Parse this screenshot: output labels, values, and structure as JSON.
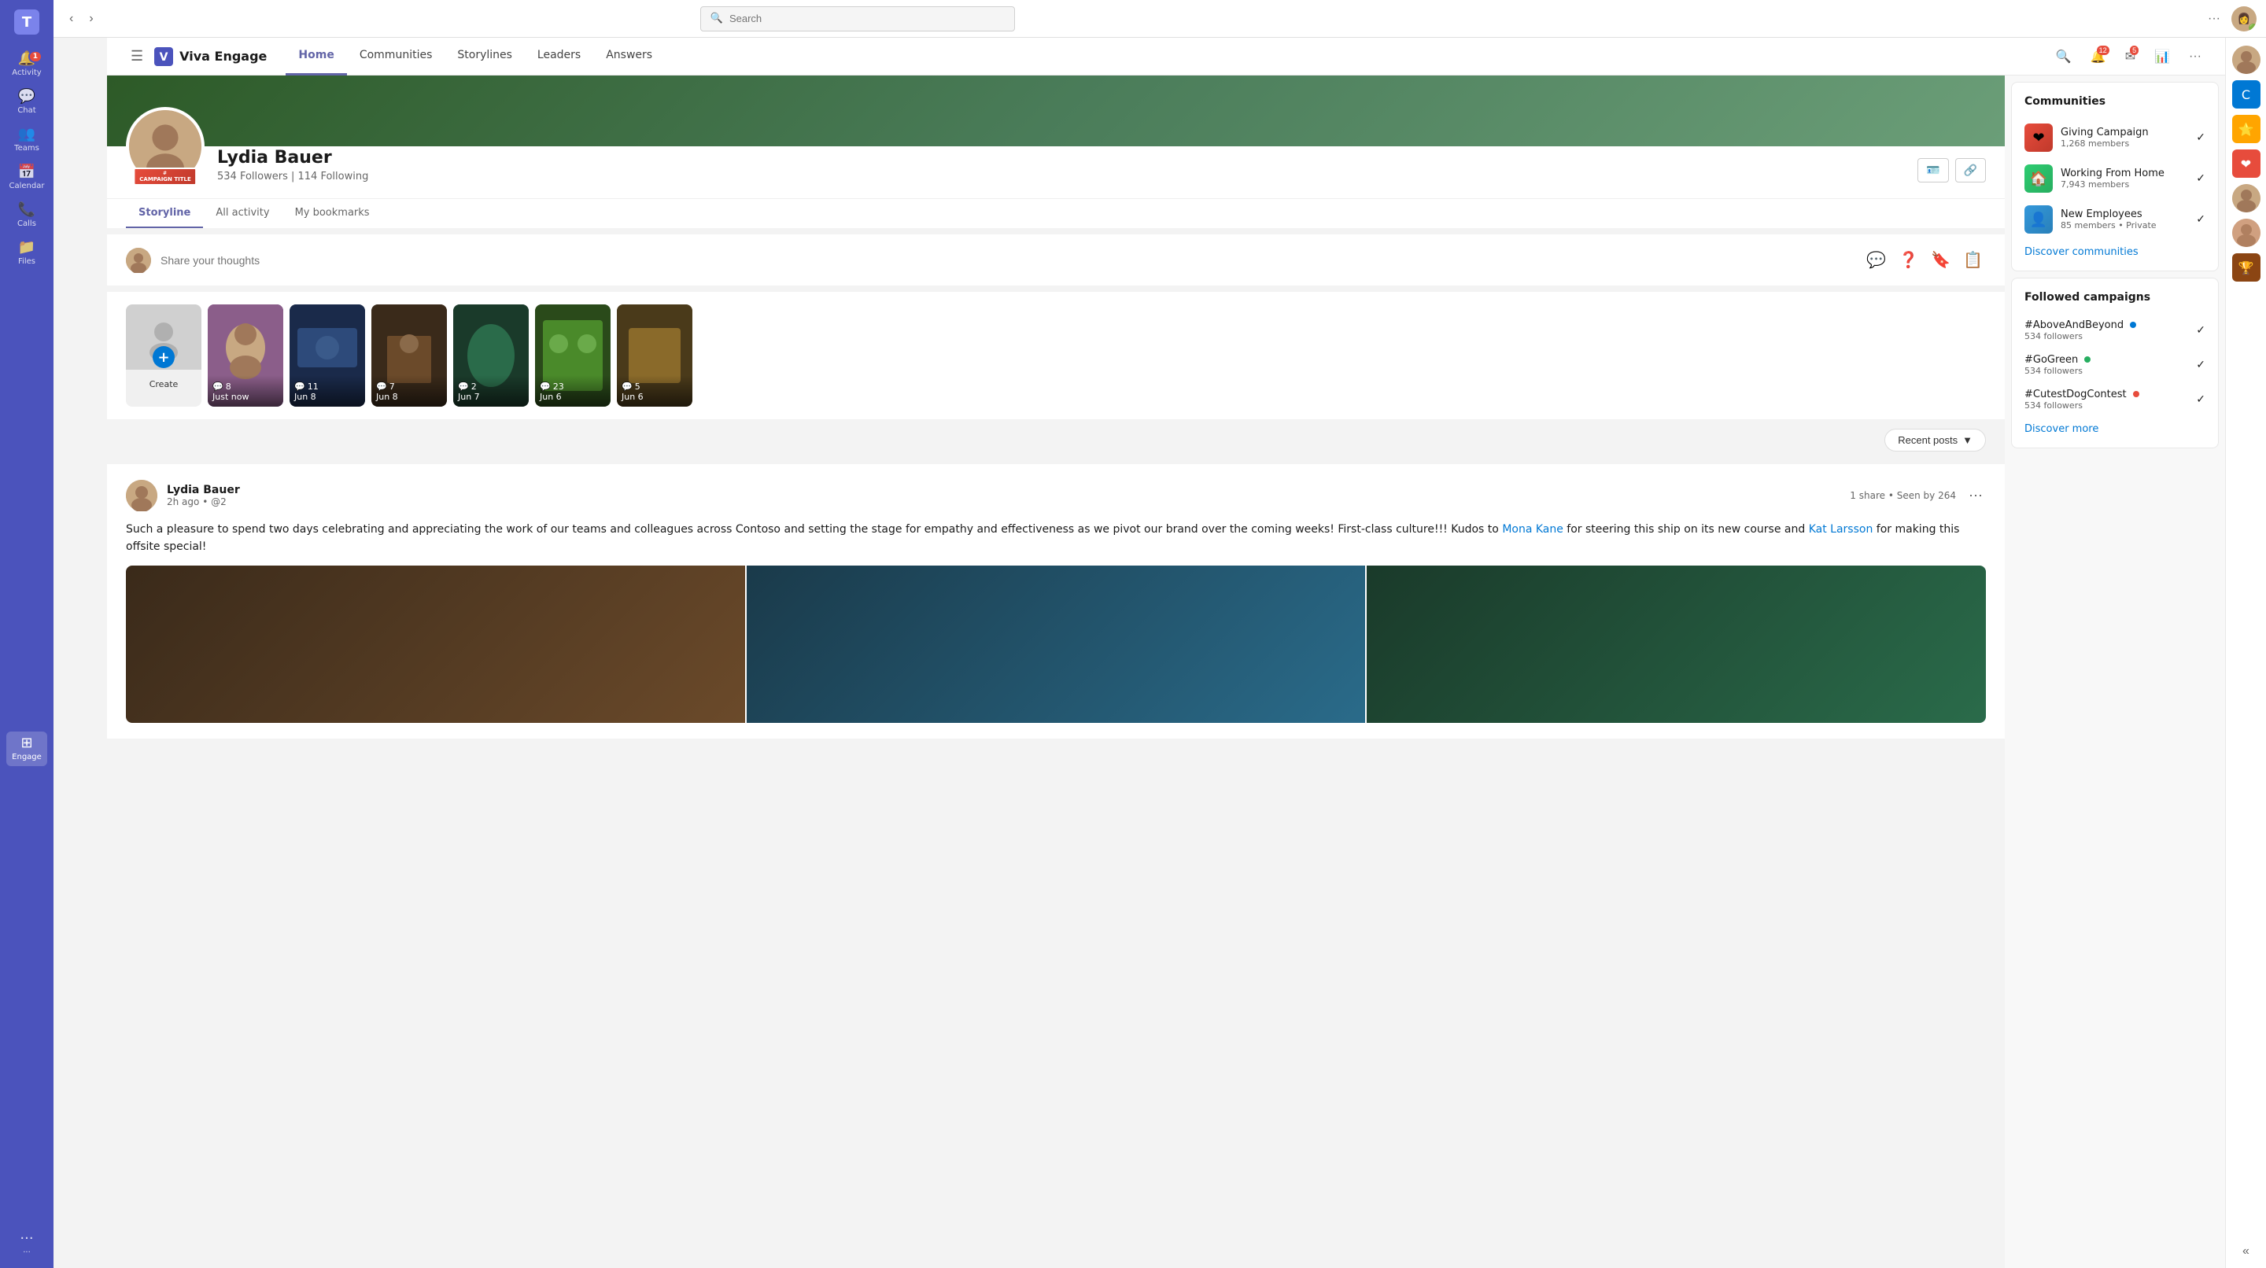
{
  "app": {
    "title": "Microsoft Teams"
  },
  "topbar": {
    "search_placeholder": "Search",
    "back_label": "‹",
    "forward_label": "›",
    "more_label": "···"
  },
  "teams_nav": {
    "items": [
      {
        "id": "activity",
        "label": "Activity",
        "icon": "🔔",
        "badge": "1",
        "active": false
      },
      {
        "id": "chat",
        "label": "Chat",
        "icon": "💬",
        "badge": null,
        "active": false
      },
      {
        "id": "teams",
        "label": "Teams",
        "icon": "👥",
        "badge": null,
        "active": false
      },
      {
        "id": "calendar",
        "label": "Calendar",
        "icon": "📅",
        "badge": null,
        "active": false
      },
      {
        "id": "calls",
        "label": "Calls",
        "icon": "📞",
        "badge": null,
        "active": false
      },
      {
        "id": "files",
        "label": "Files",
        "icon": "📁",
        "badge": null,
        "active": false
      },
      {
        "id": "engage",
        "label": "Engage",
        "icon": "⊞",
        "badge": null,
        "active": true
      }
    ],
    "more_label": "···"
  },
  "engage_header": {
    "logo_text": "Viva Engage",
    "nav_items": [
      {
        "id": "home",
        "label": "Home",
        "active": true
      },
      {
        "id": "communities",
        "label": "Communities",
        "active": false
      },
      {
        "id": "storylines",
        "label": "Storylines",
        "active": false
      },
      {
        "id": "leaders",
        "label": "Leaders",
        "active": false
      },
      {
        "id": "answers",
        "label": "Answers",
        "active": false
      }
    ],
    "search_icon": "🔍",
    "notification_icon": "🔔",
    "notification_badge": "12",
    "message_icon": "✉",
    "message_badge": "5",
    "chart_icon": "📊",
    "more_icon": "···"
  },
  "profile": {
    "name": "Lydia Bauer",
    "followers": "534 Followers",
    "following": "114 Following",
    "separator": "|",
    "campaign_badge": "CAMPAIGN TITLE",
    "tabs": [
      {
        "id": "storyline",
        "label": "Storyline",
        "active": true
      },
      {
        "id": "all_activity",
        "label": "All activity",
        "active": false
      },
      {
        "id": "bookmarks",
        "label": "My bookmarks",
        "active": false
      }
    ],
    "avatar_emoji": "👩"
  },
  "share_box": {
    "placeholder": "Share your thoughts",
    "actions": [
      {
        "id": "chat-bubble",
        "icon": "💬"
      },
      {
        "id": "question",
        "icon": "❓"
      },
      {
        "id": "bookmark",
        "icon": "🔖"
      },
      {
        "id": "list",
        "icon": "📋"
      }
    ]
  },
  "stories": [
    {
      "id": "create",
      "label": "Create",
      "type": "create"
    },
    {
      "id": "story1",
      "comments": "8",
      "date": "Just now",
      "color_class": "story-img-1"
    },
    {
      "id": "story2",
      "comments": "11",
      "date": "Jun 8",
      "color_class": "story-img-2"
    },
    {
      "id": "story3",
      "comments": "7",
      "date": "Jun 8",
      "color_class": "story-img-3"
    },
    {
      "id": "story4",
      "comments": "2",
      "date": "Jun 7",
      "color_class": "story-img-4"
    },
    {
      "id": "story5",
      "comments": "23",
      "date": "Jun 6",
      "color_class": "story-img-5"
    },
    {
      "id": "story6",
      "comments": "5",
      "date": "Jun 6",
      "color_class": "story-img-6"
    }
  ],
  "feed": {
    "recent_posts_label": "Recent posts",
    "posts": [
      {
        "id": "post1",
        "author": "Lydia Bauer",
        "time": "2h ago",
        "mention": "@2",
        "shares": "1 share",
        "seen": "Seen by 264",
        "body_part1": "Such a pleasure to spend two days celebrating and appreciating the work of our teams and colleagues across Contoso and setting the stage for empathy and effectiveness as we pivot our brand over the coming weeks! First-class culture!!! Kudos to ",
        "link1": "Mona Kane",
        "body_part2": " for steering this ship on its new course and ",
        "link2": "Kat Larsson",
        "body_part3": " for making this offsite special!"
      }
    ]
  },
  "right_sidebar": {
    "communities_title": "Communities",
    "communities": [
      {
        "id": "giving",
        "name": "Giving Campaign",
        "members": "1,268 members",
        "color_class": "comm-1",
        "icon": "❤"
      },
      {
        "id": "wfh",
        "name": "Working From Home",
        "members": "7,943 members",
        "color_class": "comm-2",
        "icon": "🏠"
      },
      {
        "id": "new_emp",
        "name": "New Employees",
        "members": "85 members • Private",
        "color_class": "comm-3",
        "icon": "👤"
      }
    ],
    "discover_communities": "Discover communities",
    "campaigns_title": "Followed campaigns",
    "campaigns": [
      {
        "id": "above",
        "tag": "#AboveAndBeyond",
        "dot_type": "blue",
        "followers": "534 followers"
      },
      {
        "id": "green",
        "tag": "#GoGreen",
        "dot_type": "green",
        "followers": "534 followers"
      },
      {
        "id": "dog",
        "tag": "#CutestDogContest",
        "dot_type": "red",
        "followers": "534 followers"
      }
    ],
    "discover_more": "Discover more"
  },
  "apps_sidebar": {
    "apps": [
      {
        "id": "profile",
        "icon": "👩",
        "type": "avatar"
      },
      {
        "id": "app1",
        "icon": "🔵"
      },
      {
        "id": "app2",
        "icon": "⭐"
      },
      {
        "id": "app3",
        "icon": "❤"
      },
      {
        "id": "app4",
        "icon": "👤"
      },
      {
        "id": "app5",
        "icon": "👥"
      },
      {
        "id": "app6",
        "icon": "🏆"
      }
    ],
    "collapse_icon": "«"
  }
}
